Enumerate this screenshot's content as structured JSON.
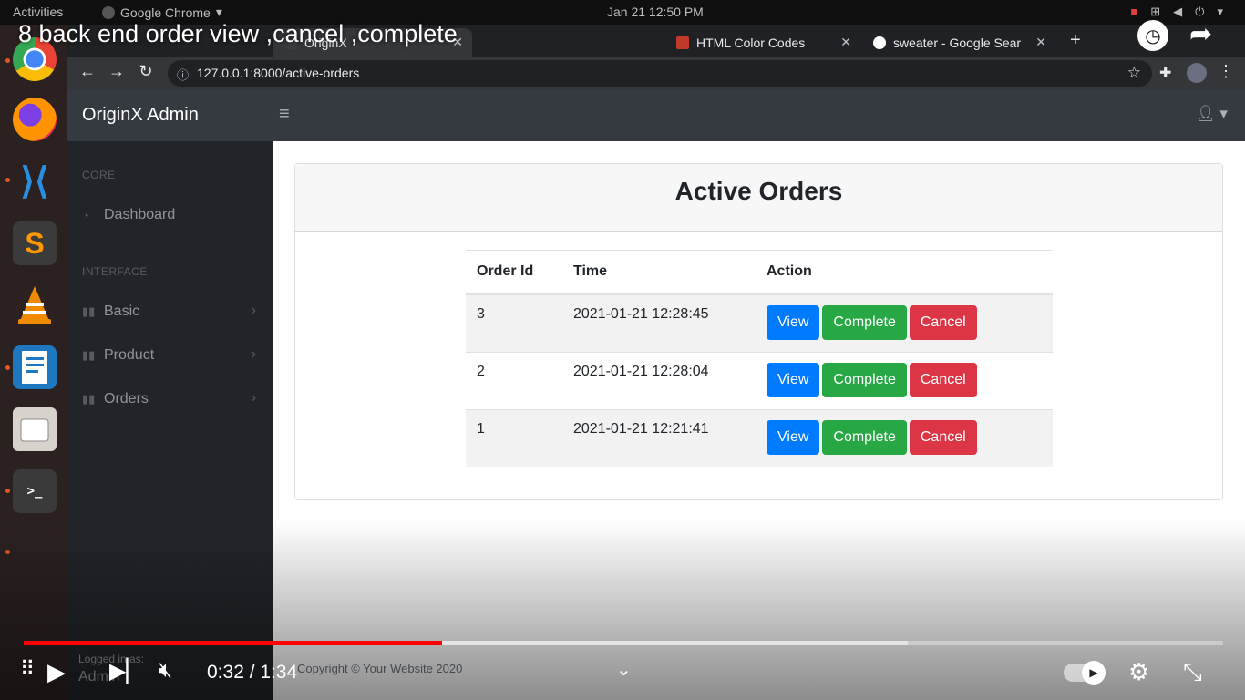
{
  "os_bar": {
    "activities": "Activities",
    "app_name": "Google Chrome",
    "clock": "Jan 21  12:50 PM"
  },
  "browser": {
    "tabs": [
      {
        "label": "OriginX"
      },
      {
        "label": "HTML Color Codes"
      },
      {
        "label": "sweater - Google Sear"
      }
    ],
    "url": "127.0.0.1:8000/active-orders"
  },
  "app": {
    "brand": "OriginX Admin",
    "sidebar": {
      "heading_core": "CORE",
      "dashboard": "Dashboard",
      "heading_interface": "INTERFACE",
      "basic": "Basic",
      "product": "Product",
      "orders": "Orders",
      "logged_in_as": "Logged in as:",
      "user": "Admin"
    },
    "card_title": "Active Orders",
    "table": {
      "headers": [
        "Order Id",
        "Time",
        "Action"
      ],
      "rows": [
        {
          "id": "3",
          "time": "2021-01-21 12:28:45"
        },
        {
          "id": "2",
          "time": "2021-01-21 12:28:04"
        },
        {
          "id": "1",
          "time": "2021-01-21 12:21:41"
        }
      ],
      "view_label": "View",
      "complete_label": "Complete",
      "cancel_label": "Cancel"
    },
    "footer": "Copyright © Your Website 2020"
  },
  "video": {
    "title": "8 back end order view ,cancel ,complete",
    "time": "0:32 / 1:34",
    "played_fraction": 0.349,
    "buffered_fraction": 0.737
  },
  "colors": {
    "primary": "#007bff",
    "success": "#28a745",
    "danger": "#dc3545",
    "navbar": "#343a40",
    "sidebar": "#212529",
    "progress": "#ff0000"
  }
}
